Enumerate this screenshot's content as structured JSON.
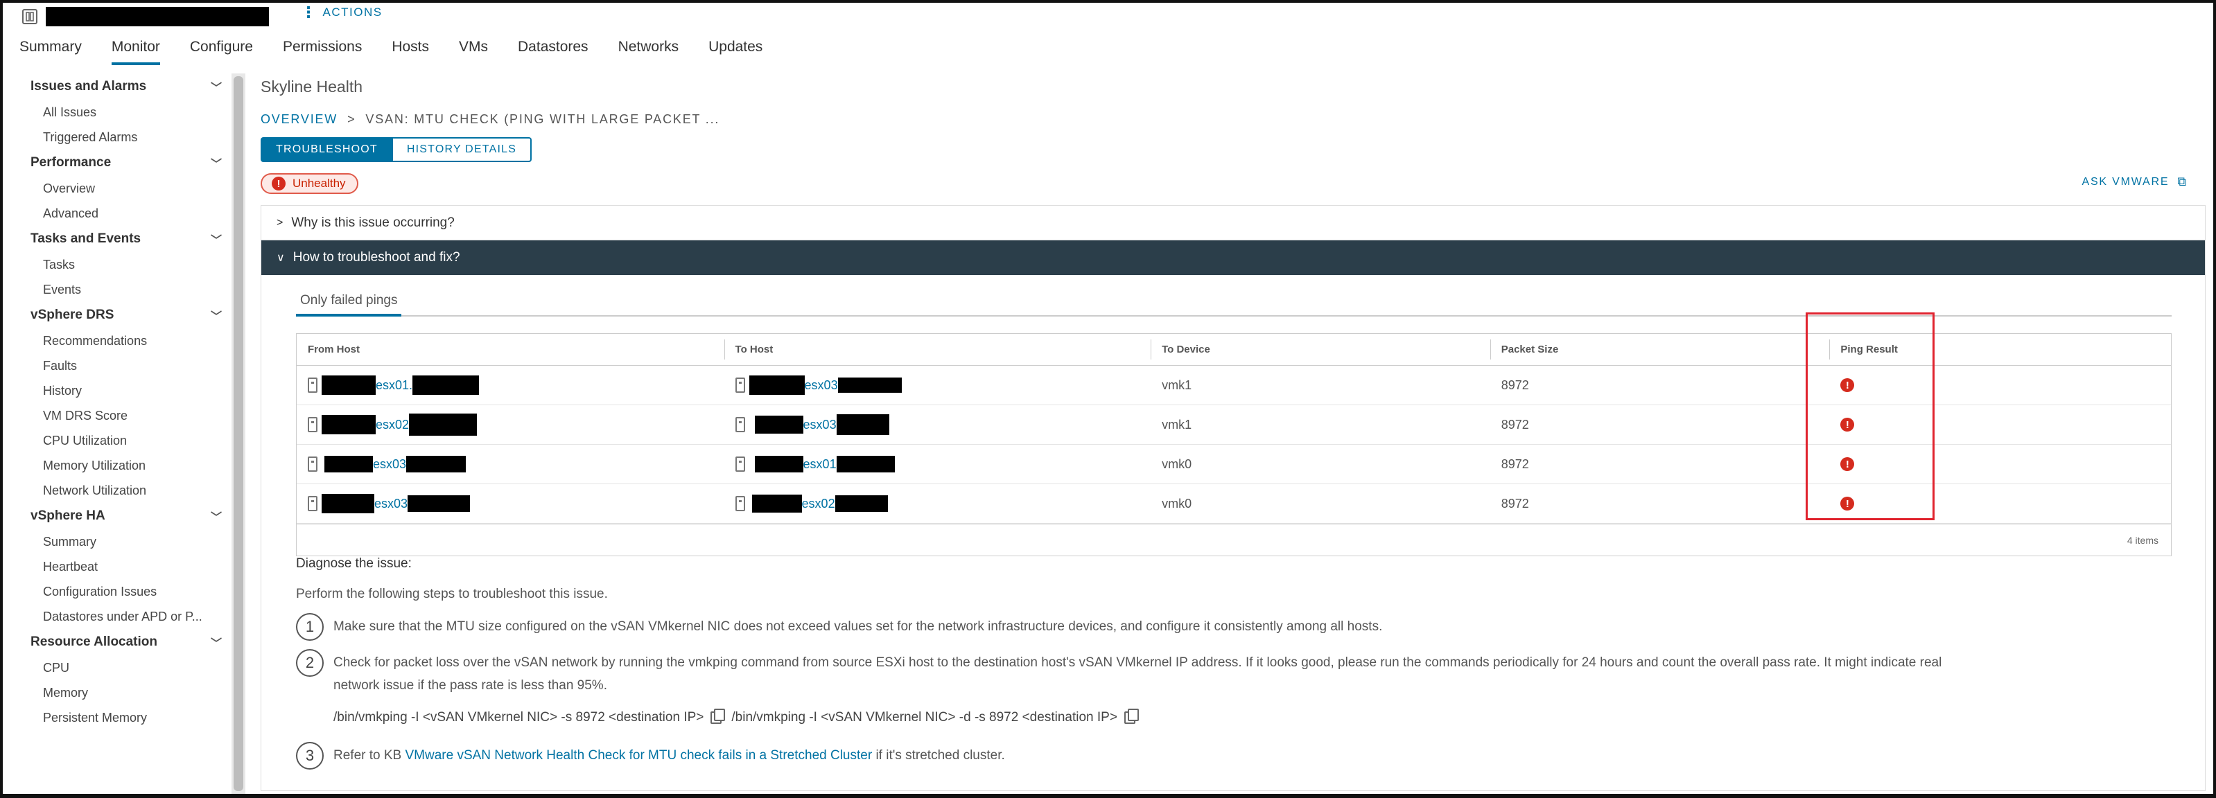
{
  "header": {
    "actions_label": "ACTIONS"
  },
  "tabs": [
    "Summary",
    "Monitor",
    "Configure",
    "Permissions",
    "Hosts",
    "VMs",
    "Datastores",
    "Networks",
    "Updates"
  ],
  "sidebar": [
    {
      "title": "Issues and Alarms",
      "items": [
        "All Issues",
        "Triggered Alarms"
      ]
    },
    {
      "title": "Performance",
      "items": [
        "Overview",
        "Advanced"
      ]
    },
    {
      "title": "Tasks and Events",
      "items": [
        "Tasks",
        "Events"
      ]
    },
    {
      "title": "vSphere DRS",
      "items": [
        "Recommendations",
        "Faults",
        "History",
        "VM DRS Score",
        "CPU Utilization",
        "Memory Utilization",
        "Network Utilization"
      ]
    },
    {
      "title": "vSphere HA",
      "items": [
        "Summary",
        "Heartbeat",
        "Configuration Issues",
        "Datastores under APD or P..."
      ]
    },
    {
      "title": "Resource Allocation",
      "items": [
        "CPU",
        "Memory",
        "Persistent Memory"
      ]
    }
  ],
  "main": {
    "title": "Skyline Health",
    "breadcrumb_link": "OVERVIEW",
    "breadcrumb_current": "VSAN: MTU CHECK (PING WITH LARGE PACKET ...",
    "btn_troubleshoot": "TROUBLESHOOT",
    "btn_history": "HISTORY DETAILS",
    "status": "Unhealthy",
    "ask_vmware": "ASK VMWARE",
    "accordion_why": "Why is this issue occurring?",
    "accordion_how": "How to troubleshoot and fix?",
    "subtab": "Only failed pings",
    "columns": [
      "From Host",
      "To Host",
      "To Device",
      "Packet Size",
      "Ping Result"
    ],
    "rows": [
      {
        "from": "esx01.",
        "to": "esx03",
        "device": "vmk1",
        "size": "8972"
      },
      {
        "from": "esx02",
        "to": "esx03",
        "device": "vmk1",
        "size": "8972"
      },
      {
        "from": "esx03",
        "to": "esx01",
        "device": "vmk0",
        "size": "8972"
      },
      {
        "from": "esx03",
        "to": "esx02",
        "device": "vmk0",
        "size": "8972"
      }
    ],
    "item_count": "4 items",
    "diagnose_title": "Diagnose the issue:",
    "diagnose_intro": "Perform the following steps to troubleshoot this issue.",
    "step1_num": "1",
    "step1": "Make sure that the MTU size configured on the vSAN VMkernel NIC does not exceed values set for the network infrastructure devices, and configure it consistently among all hosts.",
    "step2_num": "2",
    "step2_line1": "Check for packet loss over the vSAN network by running the vmkping command from source ESXi host to the destination host's vSAN VMkernel IP address. If it looks good, please run the commands periodically for 24 hours and count the overall pass rate. It might indicate real",
    "step2_line2": "network issue if the pass rate is less than 95%.",
    "cmd1": "/bin/vmkping -I <vSAN VMkernel NIC> -s 8972 <destination IP>",
    "cmd2": "/bin/vmkping -I <vSAN VMkernel NIC> -d -s 8972 <destination IP>",
    "step3_num": "3",
    "step3_prefix": "Refer to KB",
    "step3_link": "VMware vSAN Network Health Check for MTU check fails in a Stretched Cluster",
    "step3_suffix": "if it's stretched cluster."
  }
}
